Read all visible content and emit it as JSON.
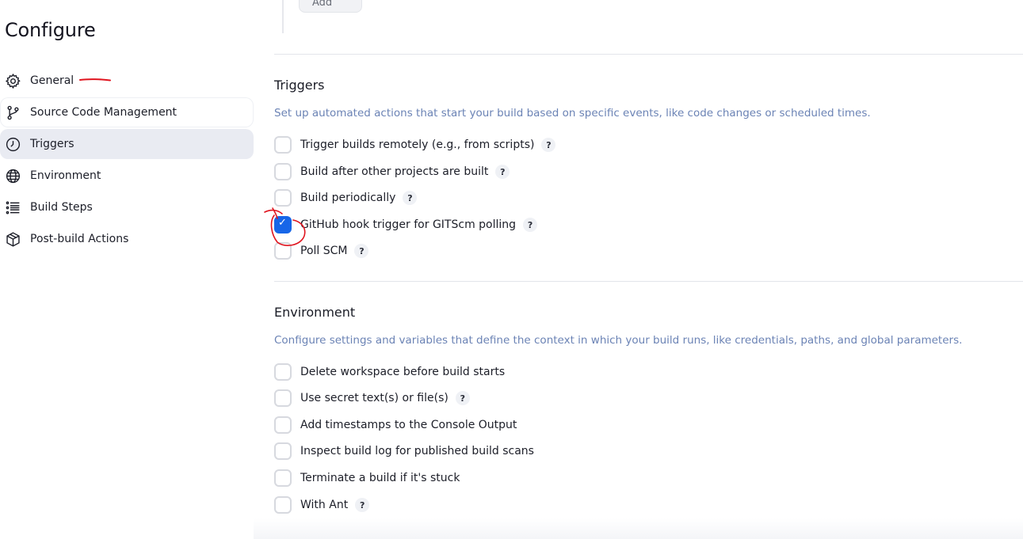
{
  "page": {
    "title": "Configure"
  },
  "top_stub": {
    "add_label": "Add"
  },
  "sidebar": {
    "items": [
      {
        "label": "General",
        "icon": "gear-icon"
      },
      {
        "label": "Source Code Management",
        "icon": "branch-icon"
      },
      {
        "label": "Triggers",
        "icon": "timer-icon"
      },
      {
        "label": "Environment",
        "icon": "globe-icon"
      },
      {
        "label": "Build Steps",
        "icon": "list-icon"
      },
      {
        "label": "Post-build Actions",
        "icon": "package-icon"
      }
    ],
    "active": "Triggers"
  },
  "triggers": {
    "title": "Triggers",
    "description": "Set up automated actions that start your build based on specific events, like code changes or scheduled times.",
    "options": [
      {
        "label": "Trigger builds remotely (e.g., from scripts)",
        "checked": false,
        "help": "?"
      },
      {
        "label": "Build after other projects are built",
        "checked": false,
        "help": "?"
      },
      {
        "label": "Build periodically",
        "checked": false,
        "help": "?"
      },
      {
        "label": "GitHub hook trigger for GITScm polling",
        "checked": true,
        "help": "?"
      },
      {
        "label": "Poll SCM",
        "checked": false,
        "help": "?"
      }
    ]
  },
  "environment": {
    "title": "Environment",
    "description": "Configure settings and variables that define the context in which your build runs, like credentials, paths, and global parameters.",
    "options": [
      {
        "label": "Delete workspace before build starts",
        "checked": false
      },
      {
        "label": "Use secret text(s) or file(s)",
        "checked": false,
        "help": "?"
      },
      {
        "label": "Add timestamps to the Console Output",
        "checked": false
      },
      {
        "label": "Inspect build log for published build scans",
        "checked": false
      },
      {
        "label": "Terminate a build if it's stuck",
        "checked": false
      },
      {
        "label": "With Ant",
        "checked": false,
        "help": "?"
      }
    ]
  },
  "colors": {
    "accent": "#1766e8",
    "annotation": "#e0141e",
    "description": "#6b83b5"
  }
}
